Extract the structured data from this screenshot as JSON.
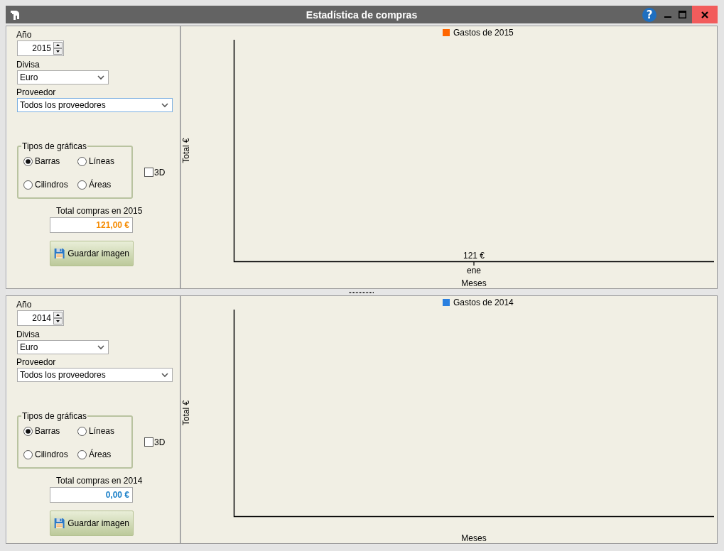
{
  "window": {
    "title": "Estadística de compras",
    "help": "?"
  },
  "panels": [
    {
      "year": {
        "label": "Año",
        "value": "2015"
      },
      "currency": {
        "label": "Divisa",
        "value": "Euro",
        "focused": false
      },
      "supplier": {
        "label": "Proveedor",
        "value": "Todos los proveedores",
        "focused": true
      },
      "chart_types": {
        "title": "Tipos de gráficas",
        "options": [
          {
            "label": "Barras",
            "selected": true
          },
          {
            "label": "Líneas",
            "selected": false
          },
          {
            "label": "Cilindros",
            "selected": false
          },
          {
            "label": "Áreas",
            "selected": false
          }
        ]
      },
      "three_d": {
        "label": "3D",
        "checked": false
      },
      "total": {
        "label": "Total compras en 2015",
        "value": "121,00 €",
        "color": "#f58a00"
      },
      "save_button": "Guardar imagen",
      "chart": {
        "xlabel": "Meses",
        "ylabel": "Total €",
        "categories": [
          "ene"
        ],
        "series": [
          {
            "name": "Gastos de 2015",
            "color": "#ff6600"
          }
        ],
        "value_labels": [
          "121 €"
        ]
      }
    },
    {
      "year": {
        "label": "Año",
        "value": "2014"
      },
      "currency": {
        "label": "Divisa",
        "value": "Euro",
        "focused": false
      },
      "supplier": {
        "label": "Proveedor",
        "value": "Todos los proveedores",
        "focused": false
      },
      "chart_types": {
        "title": "Tipos de gráficas",
        "options": [
          {
            "label": "Barras",
            "selected": true
          },
          {
            "label": "Líneas",
            "selected": false
          },
          {
            "label": "Cilindros",
            "selected": false
          },
          {
            "label": "Áreas",
            "selected": false
          }
        ]
      },
      "three_d": {
        "label": "3D",
        "checked": false
      },
      "total": {
        "label": "Total compras en 2014",
        "value": "0,00 €",
        "color": "#1a7fc8"
      },
      "save_button": "Guardar imagen",
      "chart": {
        "xlabel": "Meses",
        "ylabel": "Total €",
        "series": [
          {
            "name": "Gastos de 2014",
            "color": "#2a80e0"
          }
        ]
      }
    }
  ]
}
